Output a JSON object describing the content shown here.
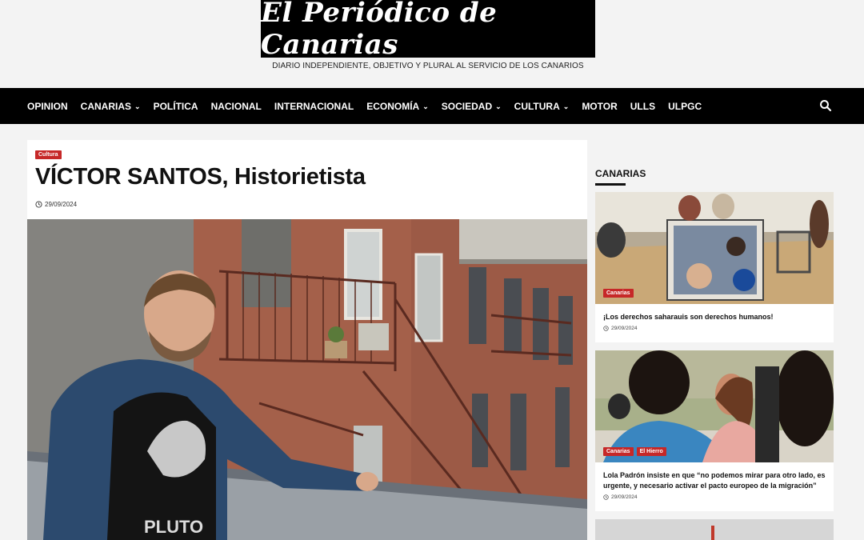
{
  "site": {
    "logo_text": "El Periódico de Canarias",
    "tagline": "DIARIO INDEPENDIENTE, OBJETIVO Y PLURAL AL SERVICIO DE LOS CANARIOS"
  },
  "nav": {
    "items": [
      {
        "label": "OPINION",
        "dropdown": false
      },
      {
        "label": "CANARIAS",
        "dropdown": true
      },
      {
        "label": "POLÍTICA",
        "dropdown": false
      },
      {
        "label": "NACIONAL",
        "dropdown": false
      },
      {
        "label": "INTERNACIONAL",
        "dropdown": false
      },
      {
        "label": "ECONOMÍA",
        "dropdown": true
      },
      {
        "label": "SOCIEDAD",
        "dropdown": true
      },
      {
        "label": "CULTURA",
        "dropdown": true
      },
      {
        "label": "MOTOR",
        "dropdown": false
      },
      {
        "label": "ULLS",
        "dropdown": false
      },
      {
        "label": "ULPGC",
        "dropdown": false
      }
    ],
    "chevron": "⌄",
    "search_icon": "search-icon"
  },
  "article": {
    "category": "Cultura",
    "title": "VÍCTOR SANTOS, Historietista",
    "date": "29/09/2024"
  },
  "sidebar": {
    "heading": "CANARIAS",
    "cards": [
      {
        "badges": [
          "Canarias"
        ],
        "title": "¡Los derechos saharauis son derechos humanos!",
        "date": "29/09/2024"
      },
      {
        "badges": [
          "Canarias",
          "El Hierro"
        ],
        "title": "Lola Padrón insiste en que “no podemos mirar para otro lado, es urgente, y necesario activar el pacto europeo de la migración”",
        "date": "29/09/2024"
      }
    ]
  },
  "colors": {
    "accent": "#c62828",
    "nav_bg": "#000000",
    "page_bg": "#f3f3f3"
  }
}
